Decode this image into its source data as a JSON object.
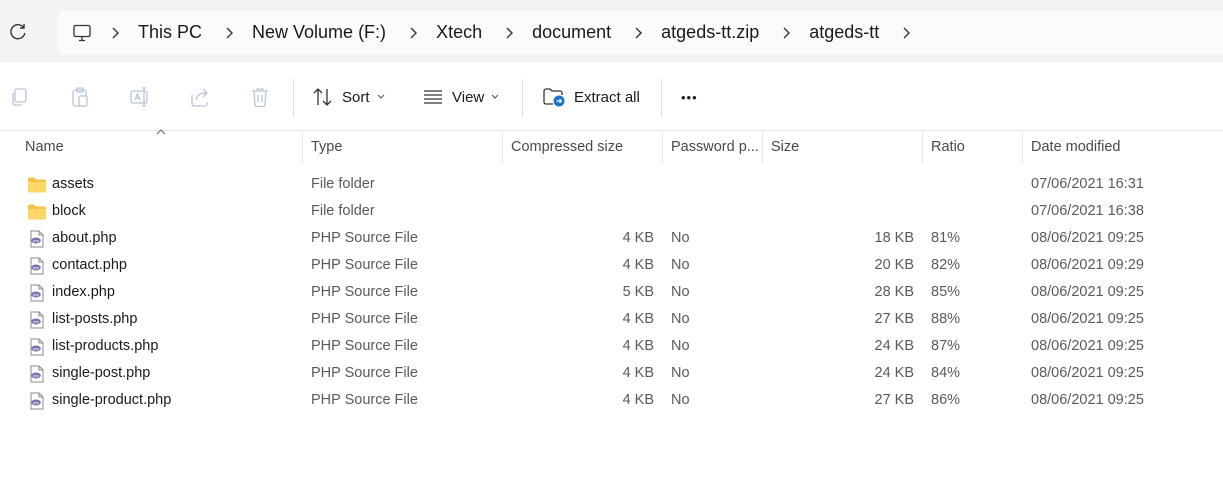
{
  "breadcrumbs": [
    "This PC",
    "New Volume (F:)",
    "Xtech",
    "document",
    "atgeds-tt.zip",
    "atgeds-tt"
  ],
  "toolbar": {
    "sort_label": "Sort",
    "view_label": "View",
    "extract_label": "Extract all",
    "more_label": "•••"
  },
  "columns": {
    "name": "Name",
    "type": "Type",
    "compressed": "Compressed size",
    "password": "Password p...",
    "size": "Size",
    "ratio": "Ratio",
    "date": "Date modified"
  },
  "files": [
    {
      "name": "assets",
      "type": "File folder",
      "compressed": "",
      "password": "",
      "size": "",
      "ratio": "",
      "date": "07/06/2021 16:31",
      "icon": "folder-icon"
    },
    {
      "name": "block",
      "type": "File folder",
      "compressed": "",
      "password": "",
      "size": "",
      "ratio": "",
      "date": "07/06/2021 16:38",
      "icon": "folder-icon"
    },
    {
      "name": "about.php",
      "type": "PHP Source File",
      "compressed": "4 KB",
      "password": "No",
      "size": "18 KB",
      "ratio": "81%",
      "date": "08/06/2021 09:25",
      "icon": "php-file-icon"
    },
    {
      "name": "contact.php",
      "type": "PHP Source File",
      "compressed": "4 KB",
      "password": "No",
      "size": "20 KB",
      "ratio": "82%",
      "date": "08/06/2021 09:29",
      "icon": "php-file-icon"
    },
    {
      "name": "index.php",
      "type": "PHP Source File",
      "compressed": "5 KB",
      "password": "No",
      "size": "28 KB",
      "ratio": "85%",
      "date": "08/06/2021 09:25",
      "icon": "php-file-icon"
    },
    {
      "name": "list-posts.php",
      "type": "PHP Source File",
      "compressed": "4 KB",
      "password": "No",
      "size": "27 KB",
      "ratio": "88%",
      "date": "08/06/2021 09:25",
      "icon": "php-file-icon"
    },
    {
      "name": "list-products.php",
      "type": "PHP Source File",
      "compressed": "4 KB",
      "password": "No",
      "size": "24 KB",
      "ratio": "87%",
      "date": "08/06/2021 09:25",
      "icon": "php-file-icon"
    },
    {
      "name": "single-post.php",
      "type": "PHP Source File",
      "compressed": "4 KB",
      "password": "No",
      "size": "24 KB",
      "ratio": "84%",
      "date": "08/06/2021 09:25",
      "icon": "php-file-icon"
    },
    {
      "name": "single-product.php",
      "type": "PHP Source File",
      "compressed": "4 KB",
      "password": "No",
      "size": "27 KB",
      "ratio": "86%",
      "date": "08/06/2021 09:25",
      "icon": "php-file-icon"
    }
  ]
}
